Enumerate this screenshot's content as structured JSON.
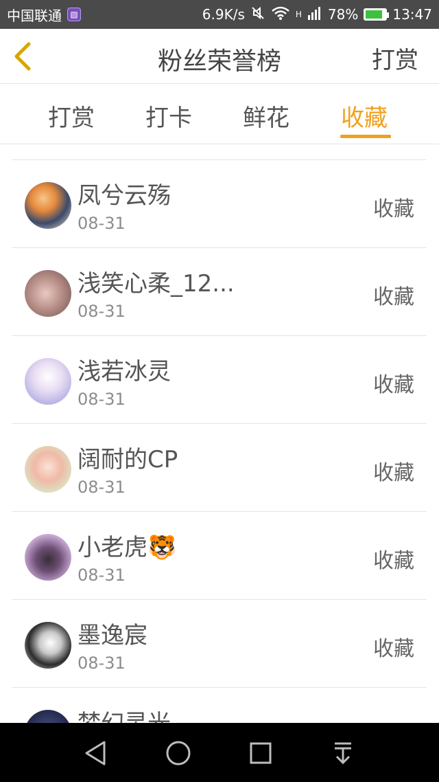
{
  "status": {
    "carrier": "中国联通",
    "speed": "6.9K/s",
    "network": "H",
    "battery": "78%",
    "time": "13:47"
  },
  "header": {
    "title": "粉丝荣誉榜",
    "right_action": "打赏"
  },
  "tabs": [
    {
      "label": "打赏"
    },
    {
      "label": "打卡"
    },
    {
      "label": "鲜花"
    },
    {
      "label": "收藏"
    }
  ],
  "active_tab": "收藏",
  "fans": [
    {
      "name": "凤兮云殇",
      "date": "08-31",
      "action": "收藏"
    },
    {
      "name": "浅笑心柔_12...",
      "date": "08-31",
      "action": "收藏"
    },
    {
      "name": "浅若冰灵",
      "date": "08-31",
      "action": "收藏"
    },
    {
      "name": "阔耐的CP",
      "date": "08-31",
      "action": "收藏"
    },
    {
      "name": "小老虎🐯",
      "date": "08-31",
      "action": "收藏"
    },
    {
      "name": "墨逸宸",
      "date": "08-31",
      "action": "收藏"
    },
    {
      "name": "梦幻灵光",
      "date": "",
      "action": ""
    }
  ],
  "colors": {
    "accent": "#f0a11f",
    "statusbar": "#4a4a4a"
  }
}
